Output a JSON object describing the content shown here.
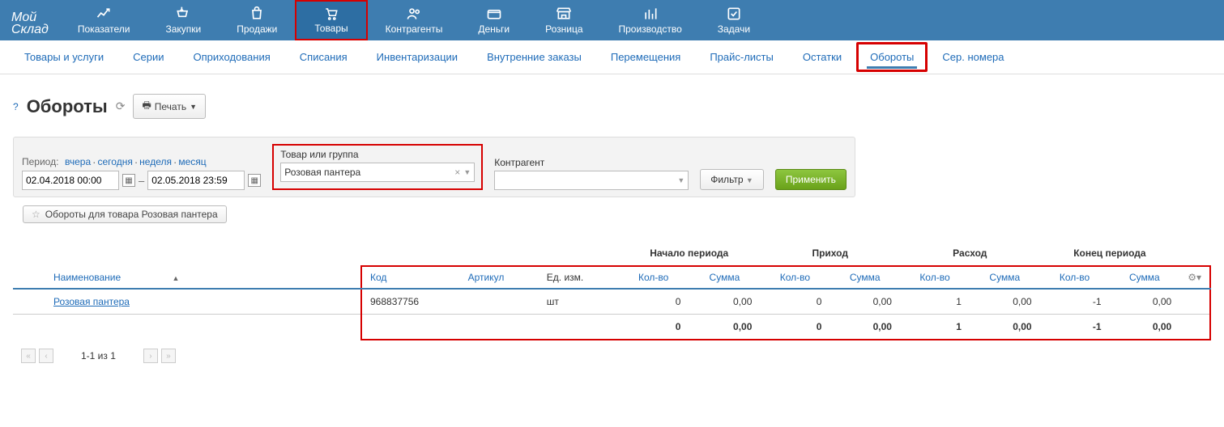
{
  "logo": {
    "l1": "Мой",
    "l2": "Склад"
  },
  "topnav": [
    {
      "label": "Показатели"
    },
    {
      "label": "Закупки"
    },
    {
      "label": "Продажи"
    },
    {
      "label": "Товары",
      "active": true
    },
    {
      "label": "Контрагенты"
    },
    {
      "label": "Деньги"
    },
    {
      "label": "Розница"
    },
    {
      "label": "Производство"
    },
    {
      "label": "Задачи"
    }
  ],
  "subnav": [
    {
      "label": "Товары и услуги"
    },
    {
      "label": "Серии"
    },
    {
      "label": "Оприходования"
    },
    {
      "label": "Списания"
    },
    {
      "label": "Инвентаризации"
    },
    {
      "label": "Внутренние заказы"
    },
    {
      "label": "Перемещения"
    },
    {
      "label": "Прайс-листы"
    },
    {
      "label": "Остатки"
    },
    {
      "label": "Обороты",
      "active": true
    },
    {
      "label": "Сер. номера"
    }
  ],
  "page": {
    "title": "Обороты",
    "print": "Печать"
  },
  "filters": {
    "period_label": "Период:",
    "period_links": [
      "вчера",
      "сегодня",
      "неделя",
      "месяц"
    ],
    "date_from": "02.04.2018 00:00",
    "date_to": "02.05.2018 23:59",
    "product_label": "Товар или группа",
    "product_value": "Розовая пантера",
    "agent_label": "Контрагент",
    "agent_value": "",
    "filter_btn": "Фильтр",
    "apply_btn": "Применить"
  },
  "saved_filter": "Обороты для товара Розовая пантера",
  "table": {
    "groups": [
      "Начало периода",
      "Приход",
      "Расход",
      "Конец периода"
    ],
    "cols": {
      "name": "Наименование",
      "code": "Код",
      "article": "Артикул",
      "unit": "Ед. изм.",
      "qty": "Кол-во",
      "sum": "Сумма"
    },
    "row": {
      "name": "Розовая пантера",
      "code": "968837756",
      "article": "",
      "unit": "шт",
      "start_qty": "0",
      "start_sum": "0,00",
      "in_qty": "0",
      "in_sum": "0,00",
      "out_qty": "1",
      "out_sum": "0,00",
      "end_qty": "-1",
      "end_sum": "0,00"
    },
    "total": {
      "start_qty": "0",
      "start_sum": "0,00",
      "in_qty": "0",
      "in_sum": "0,00",
      "out_qty": "1",
      "out_sum": "0,00",
      "end_qty": "-1",
      "end_sum": "0,00"
    }
  },
  "pager": {
    "text": "1-1 из 1"
  }
}
